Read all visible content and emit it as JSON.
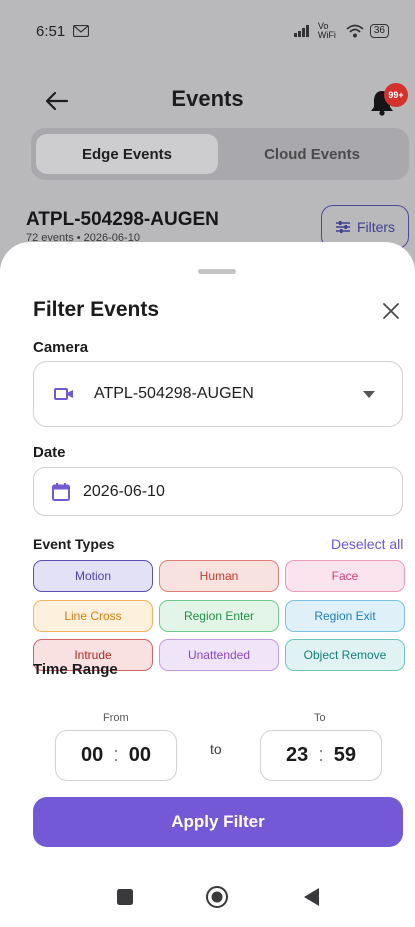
{
  "status": {
    "time": "6:51",
    "battery": "36",
    "signal_text": "Vo WiFi"
  },
  "appbar": {
    "title": "Events",
    "badge": "99+"
  },
  "segments": {
    "edge": "Edge Events",
    "cloud": "Cloud Events"
  },
  "camera_header": {
    "name": "ATPL-504298-AUGEN",
    "meta": "72 events • 2026-06-10",
    "filters_label": "Filters"
  },
  "sheet": {
    "title": "Filter Events",
    "camera_label": "Camera",
    "camera_value": "ATPL-504298-AUGEN",
    "date_label": "Date",
    "date_value": "2026-06-10",
    "event_types_label": "Event Types",
    "deselect_all": "Deselect all",
    "event_types": [
      {
        "label": "Motion",
        "bg": "#e3e1f6",
        "border": "#5b50b8",
        "color": "#4a3fae"
      },
      {
        "label": "Human",
        "bg": "#f8e2df",
        "border": "#e07f74",
        "color": "#c9392b"
      },
      {
        "label": "Face",
        "bg": "#fbe4ee",
        "border": "#ee9ab9",
        "color": "#d03f7d"
      },
      {
        "label": "Line Cross",
        "bg": "#fdf0dc",
        "border": "#f2b45a",
        "color": "#d47f08"
      },
      {
        "label": "Region Enter",
        "bg": "#e2f5e8",
        "border": "#6ccd8c",
        "color": "#1f8f49"
      },
      {
        "label": "Region Exit",
        "bg": "#dff0f9",
        "border": "#79c0e4",
        "color": "#1f7fb1"
      },
      {
        "label": "Intrude",
        "bg": "#f9e1e1",
        "border": "#d26464",
        "color": "#b72626"
      },
      {
        "label": "Unattended",
        "bg": "#f0e4f8",
        "border": "#c39be2",
        "color": "#8d46c9"
      },
      {
        "label": "Object Remove",
        "bg": "#e0f3f2",
        "border": "#6cc5bf",
        "color": "#147f78"
      }
    ],
    "time_range_label": "Time Range",
    "from_label": "From",
    "to_label": "To",
    "to_word": "to",
    "from_hour": "00",
    "from_minute": "00",
    "to_hour": "23",
    "to_minute": "59",
    "time_separator": ":",
    "apply_label": "Apply Filter"
  },
  "colors": {
    "accent": "#7459d6",
    "scrim": "#b9b9bc"
  }
}
